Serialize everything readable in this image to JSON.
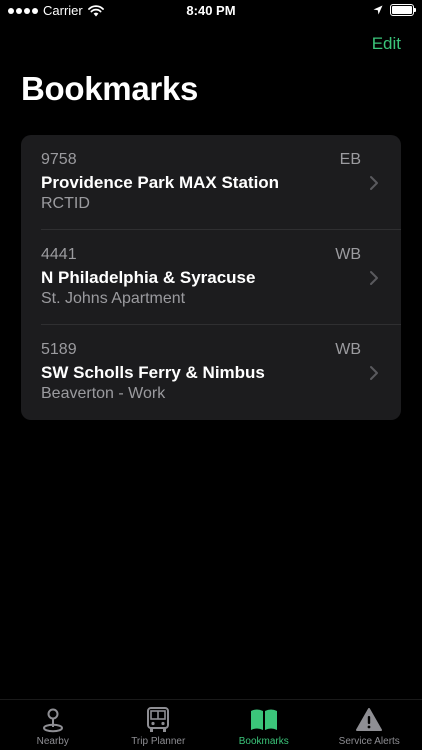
{
  "status_bar": {
    "carrier": "Carrier",
    "time": "8:40 PM"
  },
  "header": {
    "edit_label": "Edit",
    "title": "Bookmarks"
  },
  "bookmarks": [
    {
      "stop_id": "9758",
      "direction": "EB",
      "name": "Providence Park MAX Station",
      "note": "RCTID"
    },
    {
      "stop_id": "4441",
      "direction": "WB",
      "name": "N Philadelphia & Syracuse",
      "note": "St. Johns Apartment"
    },
    {
      "stop_id": "5189",
      "direction": "WB",
      "name": "SW Scholls Ferry & Nimbus",
      "note": "Beaverton - Work"
    }
  ],
  "tab_bar": {
    "tabs": [
      {
        "label": "Nearby",
        "icon": "map-pin-icon",
        "active": false
      },
      {
        "label": "Trip Planner",
        "icon": "bus-icon",
        "active": false
      },
      {
        "label": "Bookmarks",
        "icon": "book-icon",
        "active": true
      },
      {
        "label": "Service Alerts",
        "icon": "warning-icon",
        "active": false
      }
    ]
  },
  "colors": {
    "accent": "#3bc57a",
    "background": "#000000",
    "card": "#1c1c1e",
    "secondary_text": "#9b9b9f",
    "inactive_tab": "#8e8e93"
  }
}
